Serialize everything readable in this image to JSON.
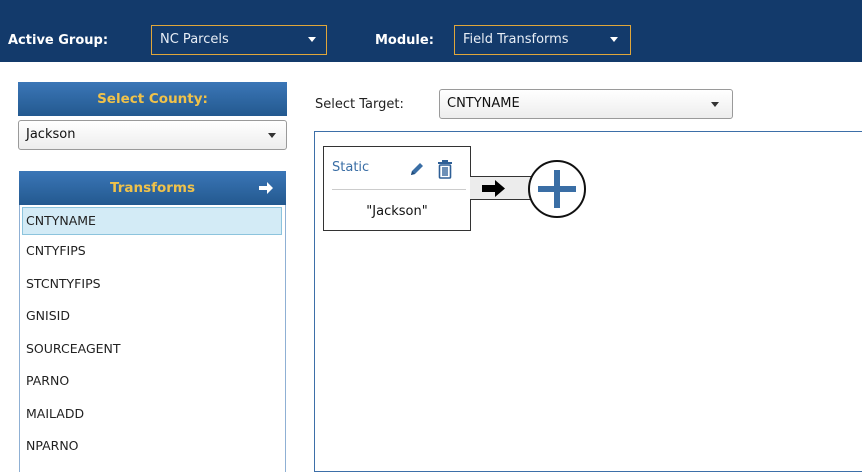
{
  "topbar": {
    "active_group_label": "Active Group:",
    "active_group_value": "NC Parcels",
    "module_label": "Module:",
    "module_value": "Field Transforms"
  },
  "sidebar": {
    "county_header": "Select County:",
    "county_value": "Jackson",
    "transforms_header": "Transforms",
    "transforms": [
      "CNTYNAME",
      "CNTYFIPS",
      "STCNTYFIPS",
      "GNISID",
      "SOURCEAGENT",
      "PARNO",
      "MAILADD",
      "NPARNO"
    ],
    "selected_transform": "CNTYNAME"
  },
  "main": {
    "select_target_label": "Select Target:",
    "target_value": "CNTYNAME",
    "node": {
      "type_label": "Static",
      "value": "\"Jackson\""
    }
  },
  "colors": {
    "topbar_bg": "#133a6b",
    "dropdown_border": "#e0a63a",
    "header_text": "#f0c24a",
    "accent_blue": "#3a6ea5",
    "selected_row": "#d3ebf6"
  },
  "icons": [
    "caret-down-icon",
    "arrow-right-icon",
    "pencil-icon",
    "trash-icon",
    "plus-circle-icon"
  ]
}
